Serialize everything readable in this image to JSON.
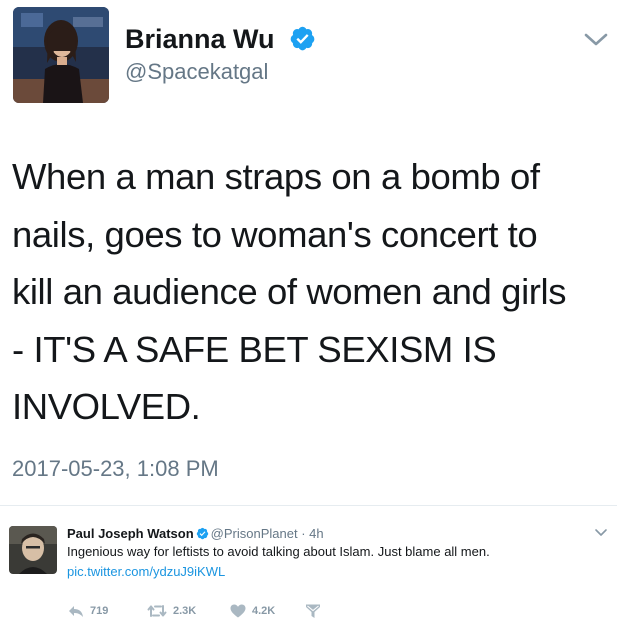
{
  "main_tweet": {
    "display_name": "Brianna Wu",
    "handle": "@Spacekatgal",
    "text_lines": [
      "When a man straps on a bomb of",
      "nails, goes to woman's concert to",
      "kill an audience of women and girls",
      "- IT'S A SAFE BET SEXISM IS",
      "INVOLVED."
    ],
    "timestamp": "2017-05-23, 1:08 PM"
  },
  "reply_tweet": {
    "display_name": "Paul Joseph Watson",
    "handle": "@PrisonPlanet",
    "separator": "·",
    "time": "4h",
    "text": "Ingenious way for leftists to avoid talking about Islam. Just blame all men.",
    "link": "pic.twitter.com/ydzuJ9iKWL",
    "actions": {
      "reply_count": "719",
      "retweet_count": "2.3K",
      "like_count": "4.2K"
    }
  },
  "icons": {
    "verified": "verified-badge-icon",
    "chevron": "chevron-down-icon",
    "reply": "reply-icon",
    "retweet": "retweet-icon",
    "like": "heart-icon",
    "dm": "direct-message-icon"
  },
  "colors": {
    "verified_blue": "#1da1f2",
    "text": "#14171a",
    "muted": "#657786",
    "link": "#1b95e0",
    "action_grey": "#8899a6"
  }
}
